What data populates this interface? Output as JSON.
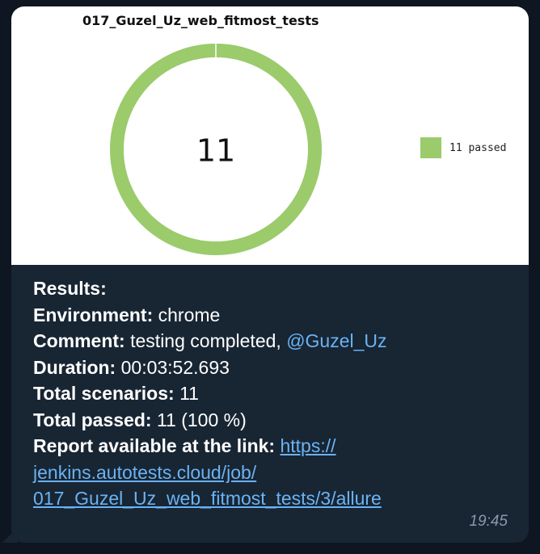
{
  "chart_data": {
    "type": "pie",
    "title": "017_Guzel_Uz_web_fitmost_tests",
    "center_label": "11",
    "series": [
      {
        "name": "11 passed",
        "values": [
          11
        ],
        "color": "#9bcb6b"
      }
    ],
    "legend_position": "right"
  },
  "message": {
    "results_label": "Results:",
    "environment_label": "Environment:",
    "environment_value": "chrome",
    "comment_label": "Comment:",
    "comment_value": "testing completed,",
    "comment_mention": "@Guzel_Uz",
    "duration_label": "Duration:",
    "duration_value": "00:03:52.693",
    "total_scenarios_label": "Total scenarios:",
    "total_scenarios_value": "11",
    "total_passed_label": "Total passed:",
    "total_passed_value": "11 (100 %)",
    "report_label": "Report available at the link:",
    "report_link_part1": "https://",
    "report_link_part2": "jenkins.autotests.cloud/job/",
    "report_link_part3": "017_Guzel_Uz_web_fitmost_tests/3/allure",
    "timestamp": "19:45"
  }
}
